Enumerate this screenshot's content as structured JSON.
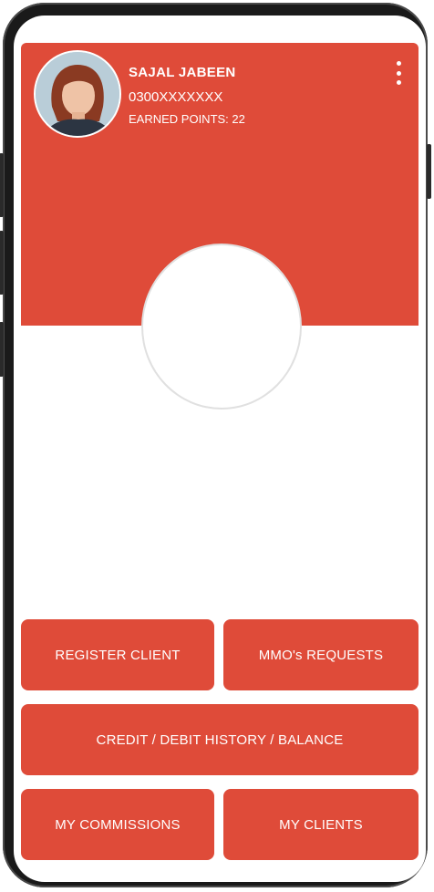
{
  "profile": {
    "name": "SAJAL JABEEN",
    "phone": "0300XXXXXXX",
    "points": "EARNED POINTS: 22"
  },
  "buttons": {
    "register_client": "REGISTER CLIENT",
    "mmo_requests": "MMO's REQUESTS",
    "credit_history": "CREDIT / DEBIT HISTORY / BALANCE",
    "my_commissions": "MY COMMISSIONS",
    "my_clients": "MY CLIENTS"
  },
  "icons": {
    "menu": "more-vertical-icon"
  },
  "colors": {
    "accent": "#df4b39",
    "background": "#ffffff"
  }
}
